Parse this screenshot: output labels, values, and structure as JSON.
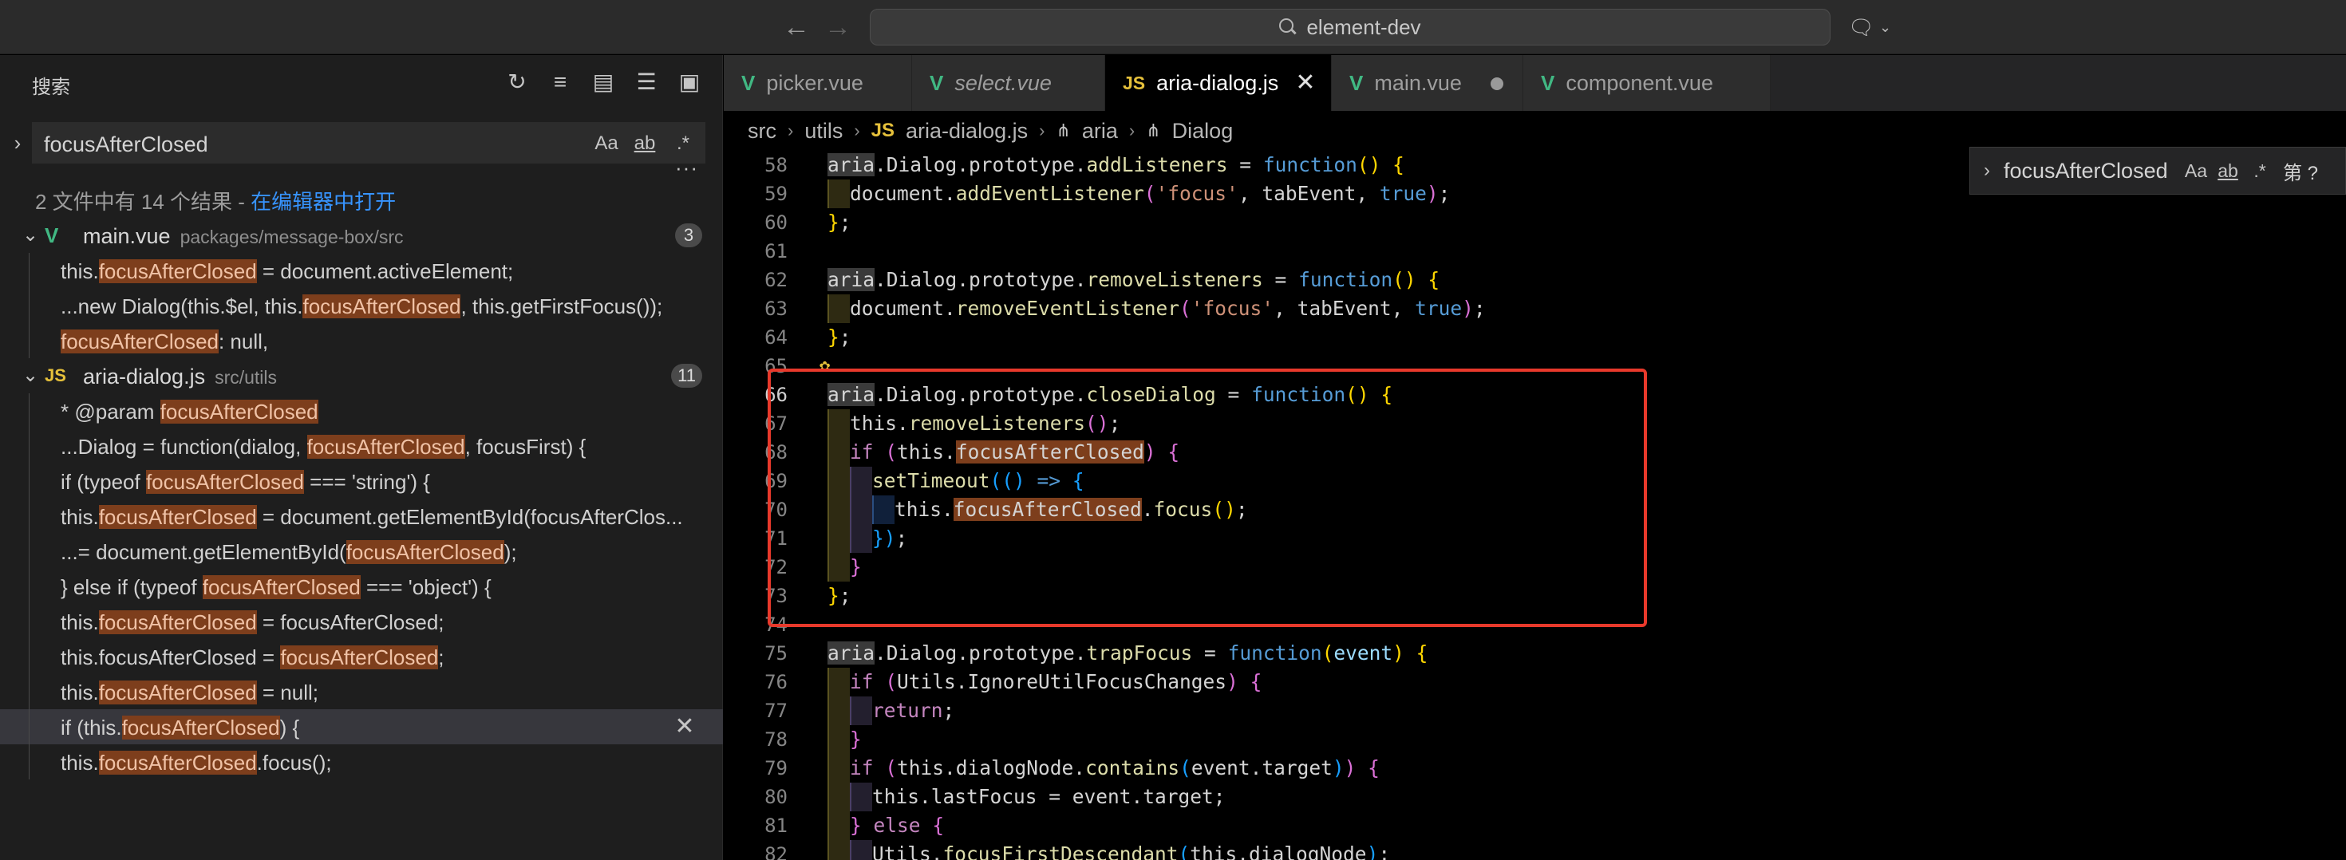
{
  "titlebar": {
    "search_text": "element-dev",
    "back_icon": "arrow-left-icon",
    "forward_icon": "arrow-right-icon",
    "copilot_icon": "copilot-chat-icon"
  },
  "sidebar": {
    "title": "搜索",
    "actions": [
      "refresh-icon",
      "clear-results-icon",
      "new-search-editor-icon",
      "collapse-all-icon",
      "view-as-tree-icon"
    ],
    "search": {
      "value": "focusAfterClosed",
      "opt_case": "Aa",
      "opt_word": "ab",
      "opt_regex": ".*"
    },
    "more": "···",
    "summary": "2 文件中有 14 个结果 - ",
    "summary_link": "在编辑器中打开",
    "files": [
      {
        "name": "main.vue",
        "path": "packages/message-box/src",
        "count": "3",
        "matches": [
          {
            "pre": "this.",
            "hl": "focusAfterClosed",
            "post": " = document.activeElement;"
          },
          {
            "pre": "...new Dialog(this.$el, this.",
            "hl": "focusAfterClosed",
            "post": ", this.getFirstFocus());"
          },
          {
            "pre": "",
            "hl": "focusAfterClosed",
            "post": ": null,"
          }
        ]
      },
      {
        "name": "aria-dialog.js",
        "path": "src/utils",
        "count": "11",
        "matches": [
          {
            "pre": "* @param ",
            "hl": "focusAfterClosed",
            "post": ""
          },
          {
            "pre": "...Dialog = function(dialog, ",
            "hl": "focusAfterClosed",
            "post": ", focusFirst) {"
          },
          {
            "pre": "if (typeof ",
            "hl": "focusAfterClosed",
            "post": " === 'string') {"
          },
          {
            "pre": "this.",
            "hl": "focusAfterClosed",
            "post": " = document.getElementById(focusAfterClos..."
          },
          {
            "pre": "...= document.getElementById(",
            "hl": "focusAfterClosed",
            "post": ");"
          },
          {
            "pre": "} else if (typeof ",
            "hl": "focusAfterClosed",
            "post": " === 'object') {"
          },
          {
            "pre": "this.",
            "hl": "focusAfterClosed",
            "post": " = focusAfterClosed;"
          },
          {
            "pre": "this.focusAfterClosed = ",
            "hl": "focusAfterClosed",
            "post": ";"
          },
          {
            "pre": "this.",
            "hl": "focusAfterClosed",
            "post": " = null;"
          },
          {
            "pre": "if (this.",
            "hl": "focusAfterClosed",
            "post": ") {"
          },
          {
            "pre": "this.",
            "hl": "focusAfterClosed",
            "post": ".focus();"
          }
        ]
      }
    ]
  },
  "tabs": [
    {
      "label": "picker.vue",
      "icon": "V",
      "kind": "vue"
    },
    {
      "label": "select.vue",
      "icon": "V",
      "kind": "vue"
    },
    {
      "label": "aria-dialog.js",
      "icon": "JS",
      "kind": "js"
    },
    {
      "label": "main.vue",
      "icon": "V",
      "kind": "vue"
    },
    {
      "label": "component.vue",
      "icon": "V",
      "kind": "vue"
    }
  ],
  "breadcrumb": {
    "parts": [
      "src",
      "utils",
      "aria-dialog.js",
      "aria",
      "Dialog"
    ],
    "js_icon": "JS"
  },
  "editor": {
    "line_numbers": [
      "58",
      "59",
      "60",
      "61",
      "62",
      "63",
      "64",
      "65",
      "66",
      "67",
      "68",
      "69",
      "70",
      "71",
      "72",
      "73",
      "74",
      "75",
      "76",
      "77",
      "78",
      "79",
      "80",
      "81",
      "82"
    ]
  },
  "find_widget": {
    "value": "focusAfterClosed",
    "opt_case": "Aa",
    "opt_word": "ab",
    "opt_regex": ".*",
    "count": "第 ?"
  },
  "colors": {
    "accent_link": "#3794ff",
    "match_highlight": "#7d3e1c",
    "annotation_box": "#e8392b",
    "vue_icon": "#41b883",
    "js_icon": "#e6c13b"
  }
}
